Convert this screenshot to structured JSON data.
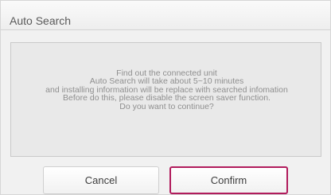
{
  "dialog": {
    "title": "Auto Search",
    "message_lines": [
      "Find out the connected unit",
      "Auto Search will take about 5~10 minutes",
      "and installing information will be replace with searched infomation",
      "Before do this, please disable the screen saver function.",
      "Do you want to continue?"
    ],
    "buttons": {
      "cancel": "Cancel",
      "confirm": "Confirm"
    }
  },
  "colors": {
    "focus_border": "#b11b5c",
    "message_text": "#8f8f8f",
    "title_text": "#5a5a5a"
  }
}
